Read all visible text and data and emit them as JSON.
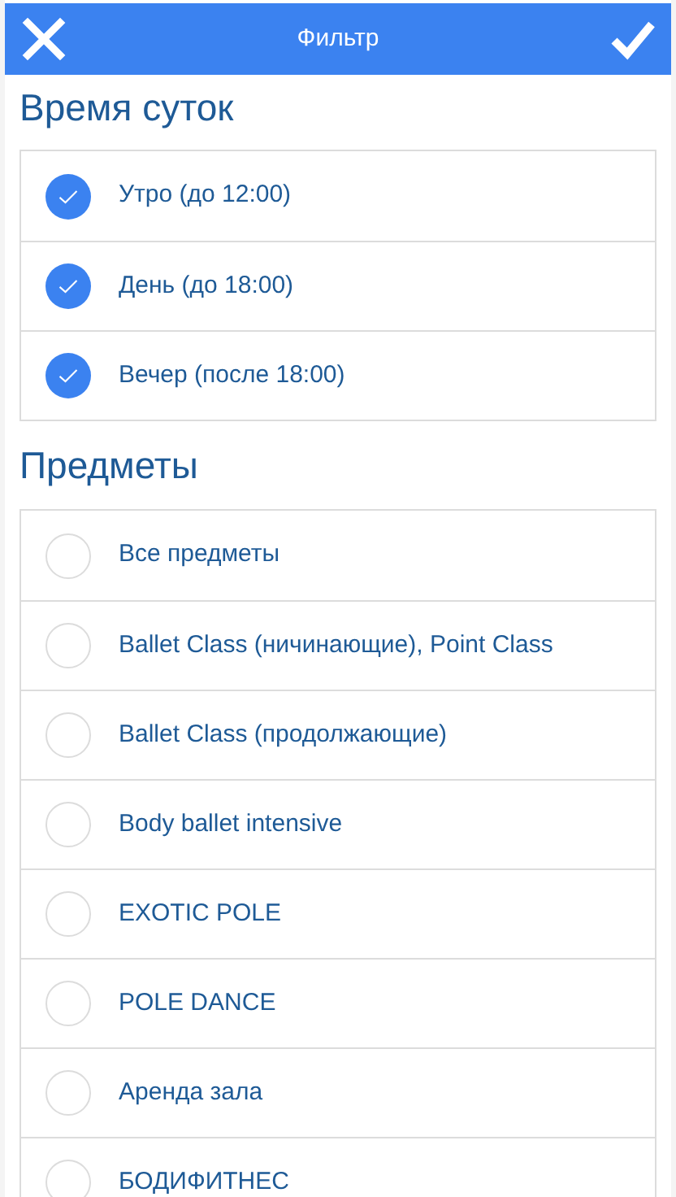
{
  "header": {
    "title": "Фильтр"
  },
  "sections": [
    {
      "title": "Время суток",
      "items": [
        {
          "label": "Утро (до 12:00)",
          "checked": true
        },
        {
          "label": "День (до 18:00)",
          "checked": true
        },
        {
          "label": "Вечер (после 18:00)",
          "checked": true
        }
      ]
    },
    {
      "title": "Предметы",
      "items": [
        {
          "label": "Все предметы",
          "checked": false
        },
        {
          "label": "Ballet Class (ничинающие), Point Class",
          "checked": false
        },
        {
          "label": "Ballet Class (продолжающие)",
          "checked": false
        },
        {
          "label": "Body ballet intensive",
          "checked": false
        },
        {
          "label": "EXOTIC POLE",
          "checked": false
        },
        {
          "label": "POLE DANCE",
          "checked": false
        },
        {
          "label": "Аренда зала",
          "checked": false
        },
        {
          "label": "БОДИФИТНЕС",
          "checked": false
        }
      ]
    }
  ]
}
